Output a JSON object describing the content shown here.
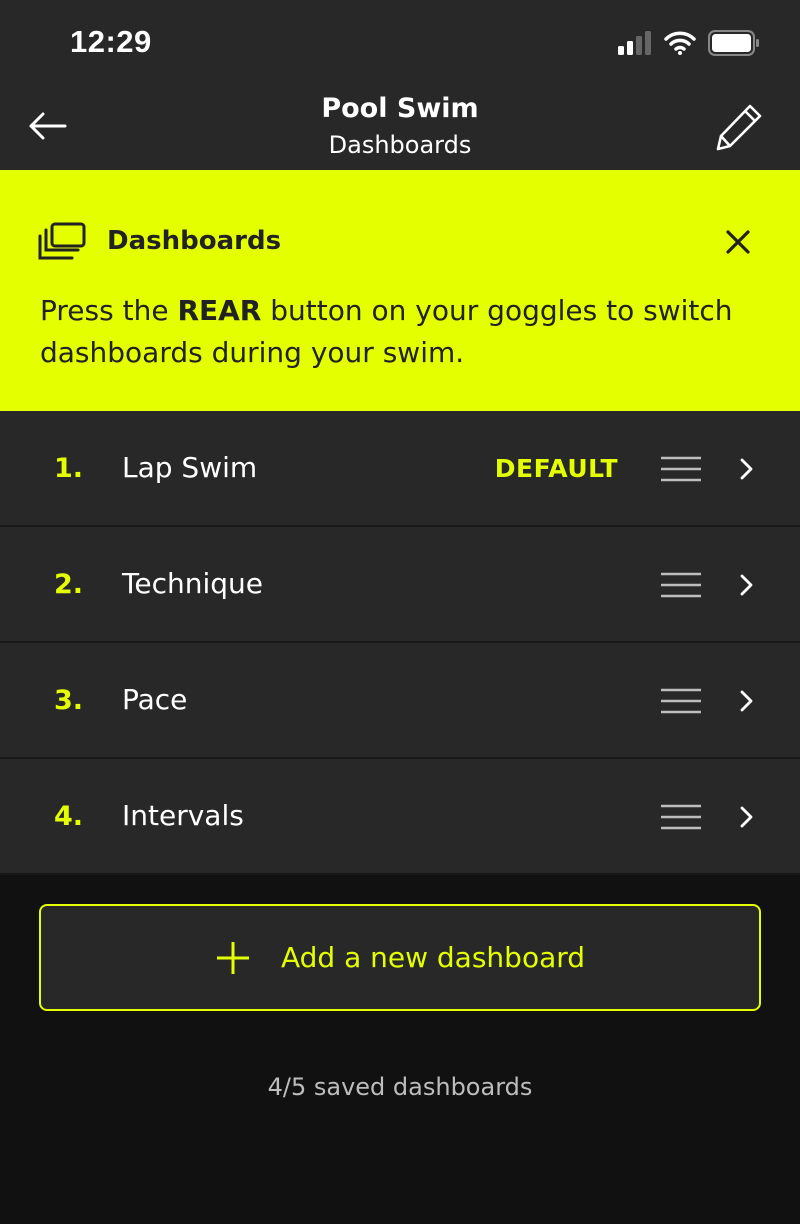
{
  "status_bar": {
    "time": "12:29",
    "icons": [
      "signal-icon",
      "wifi-icon",
      "battery-icon"
    ]
  },
  "nav": {
    "title": "Pool Swim",
    "subtitle": "Dashboards",
    "back_icon": "arrow-left-icon",
    "edit_icon": "pencil-icon"
  },
  "banner": {
    "title": "Dashboards",
    "text_before": "Press the ",
    "text_bold": "REAR",
    "text_after": " button on your goggles to switch dashboards during your swim.",
    "icon": "stacked-screens-icon",
    "close_icon": "close-icon"
  },
  "dashboards": [
    {
      "number": "1.",
      "name": "Lap Swim",
      "badge": "DEFAULT"
    },
    {
      "number": "2.",
      "name": "Technique",
      "badge": ""
    },
    {
      "number": "3.",
      "name": "Pace",
      "badge": ""
    },
    {
      "number": "4.",
      "name": "Intervals",
      "badge": ""
    }
  ],
  "add_button": {
    "label": "Add a new dashboard",
    "icon": "plus-icon"
  },
  "footer": {
    "count_text": "4/5 saved dashboards"
  },
  "colors": {
    "accent": "#e3ff00",
    "surface": "#282828",
    "background": "#111111"
  }
}
